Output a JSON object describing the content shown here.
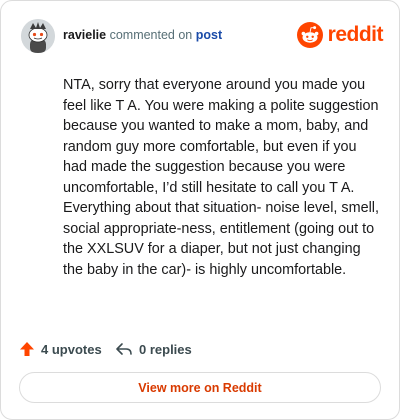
{
  "header": {
    "author": "ravielie",
    "action": "commented on",
    "post_link": "post",
    "logo_text": "reddit"
  },
  "comment": {
    "text": "NTA, sorry that everyone around you made you feel like T A. You were making a polite suggestion because you wanted to make a mom, baby, and random guy more comfortable, but even if you had made the suggestion because you were uncomfortable, I’d still hesitate to call you T A. Everything about that situation- noise level, smell, social appropriate-ness, entitlement (going out to the XXLSUV for a diaper, but not just changing the baby in the car)- is highly uncomfortable."
  },
  "footer": {
    "upvotes": "4 upvotes",
    "replies": "0 replies",
    "upvote_icon": "upvote-arrow-icon",
    "reply_icon": "reply-arrow-icon"
  },
  "cta": {
    "label": "View more on Reddit"
  },
  "colors": {
    "brand": "#ff4500",
    "link": "#1a4ba8",
    "cta": "#d93a00"
  }
}
